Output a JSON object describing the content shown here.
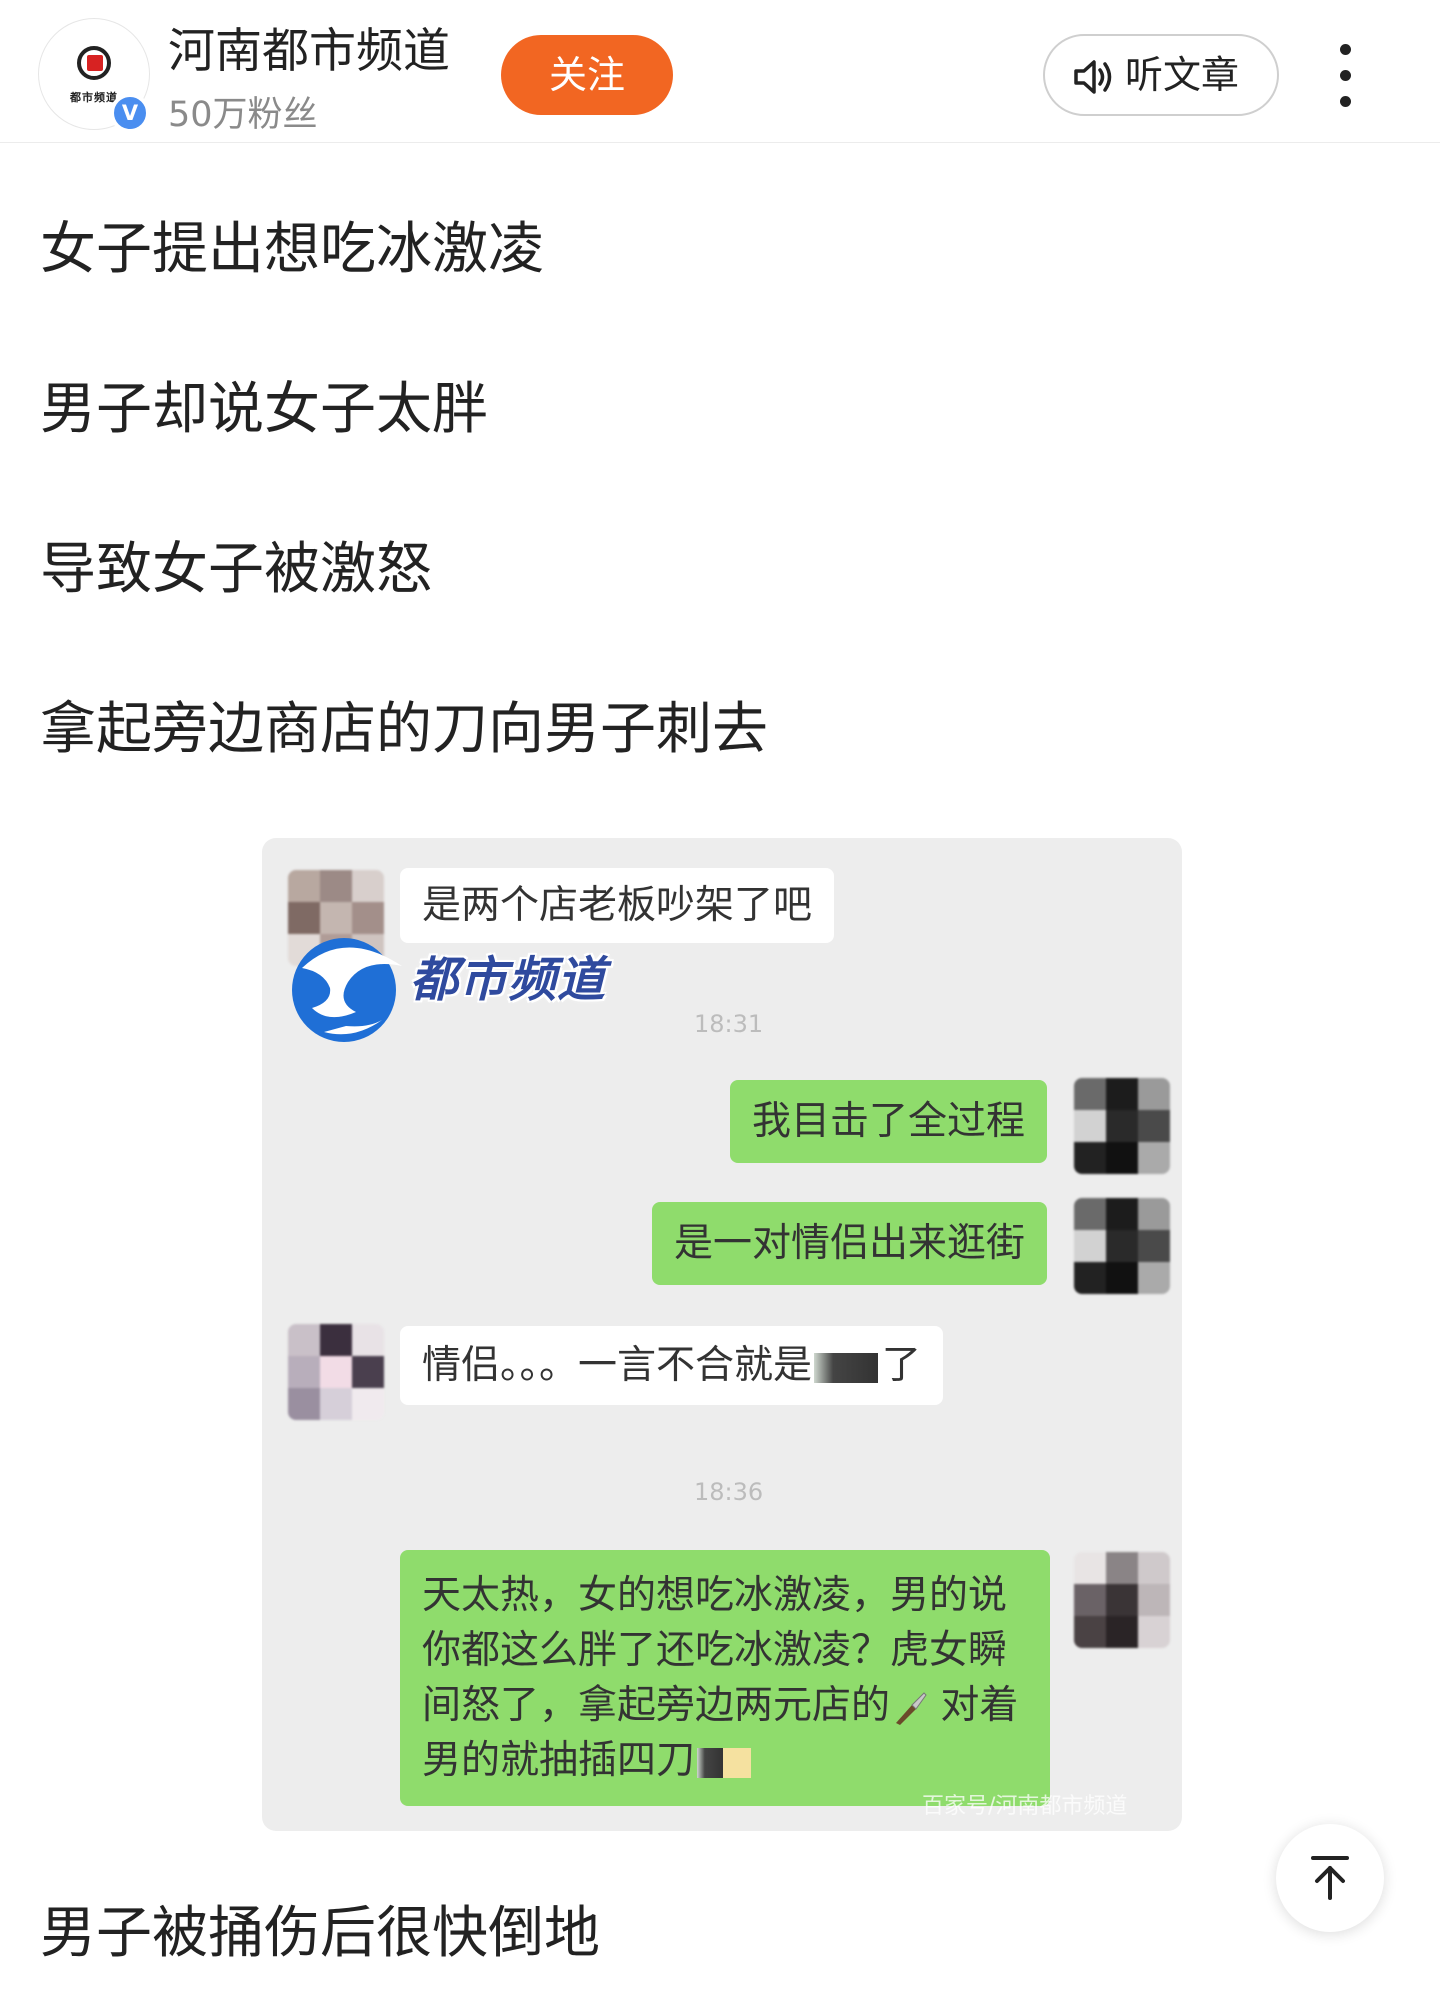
{
  "header": {
    "channel_name": "河南都市频道",
    "fans": "50万粉丝",
    "follow_label": "关注",
    "listen_label": "听文章",
    "avatar_text": "都市频道",
    "verified_badge": "V",
    "accent_color": "#f26622",
    "icons": [
      "speaker-icon",
      "more-vertical-icon",
      "verified-icon"
    ]
  },
  "article": {
    "paragraphs": [
      "女子提出想吃冰激凌",
      "男子却说女子太胖",
      "导致女子被激怒",
      "拿起旁边商店的刀向男子刺去",
      "男子被捅伤后很快倒地"
    ]
  },
  "chat_image": {
    "watermark": "都市频道",
    "messages": [
      {
        "side": "left",
        "text": "是两个店老板吵架了吧"
      },
      {
        "side": "right",
        "text": "我目击了全过程"
      },
      {
        "side": "right",
        "text": "是一对情侣出来逛街"
      },
      {
        "side": "left",
        "text": "情侣。。。一言不合就是",
        "text_after": "了"
      },
      {
        "side": "right",
        "lines": [
          "天太热，女的想吃冰激凌，男的说",
          "你都这么胖了还吃冰激凌？虎女瞬",
          "间怒了，拿起旁边两元店的",
          "男的就抽插四刀"
        ],
        "line3_after": "对着"
      }
    ],
    "timestamps": [
      "18:31",
      "18:36"
    ],
    "source": "百家号/河南都市频道",
    "bubble_colors": {
      "self": "#8fdc6c",
      "other": "#ffffff"
    }
  },
  "back_to_top": {
    "icon": "arrow-up-icon"
  }
}
